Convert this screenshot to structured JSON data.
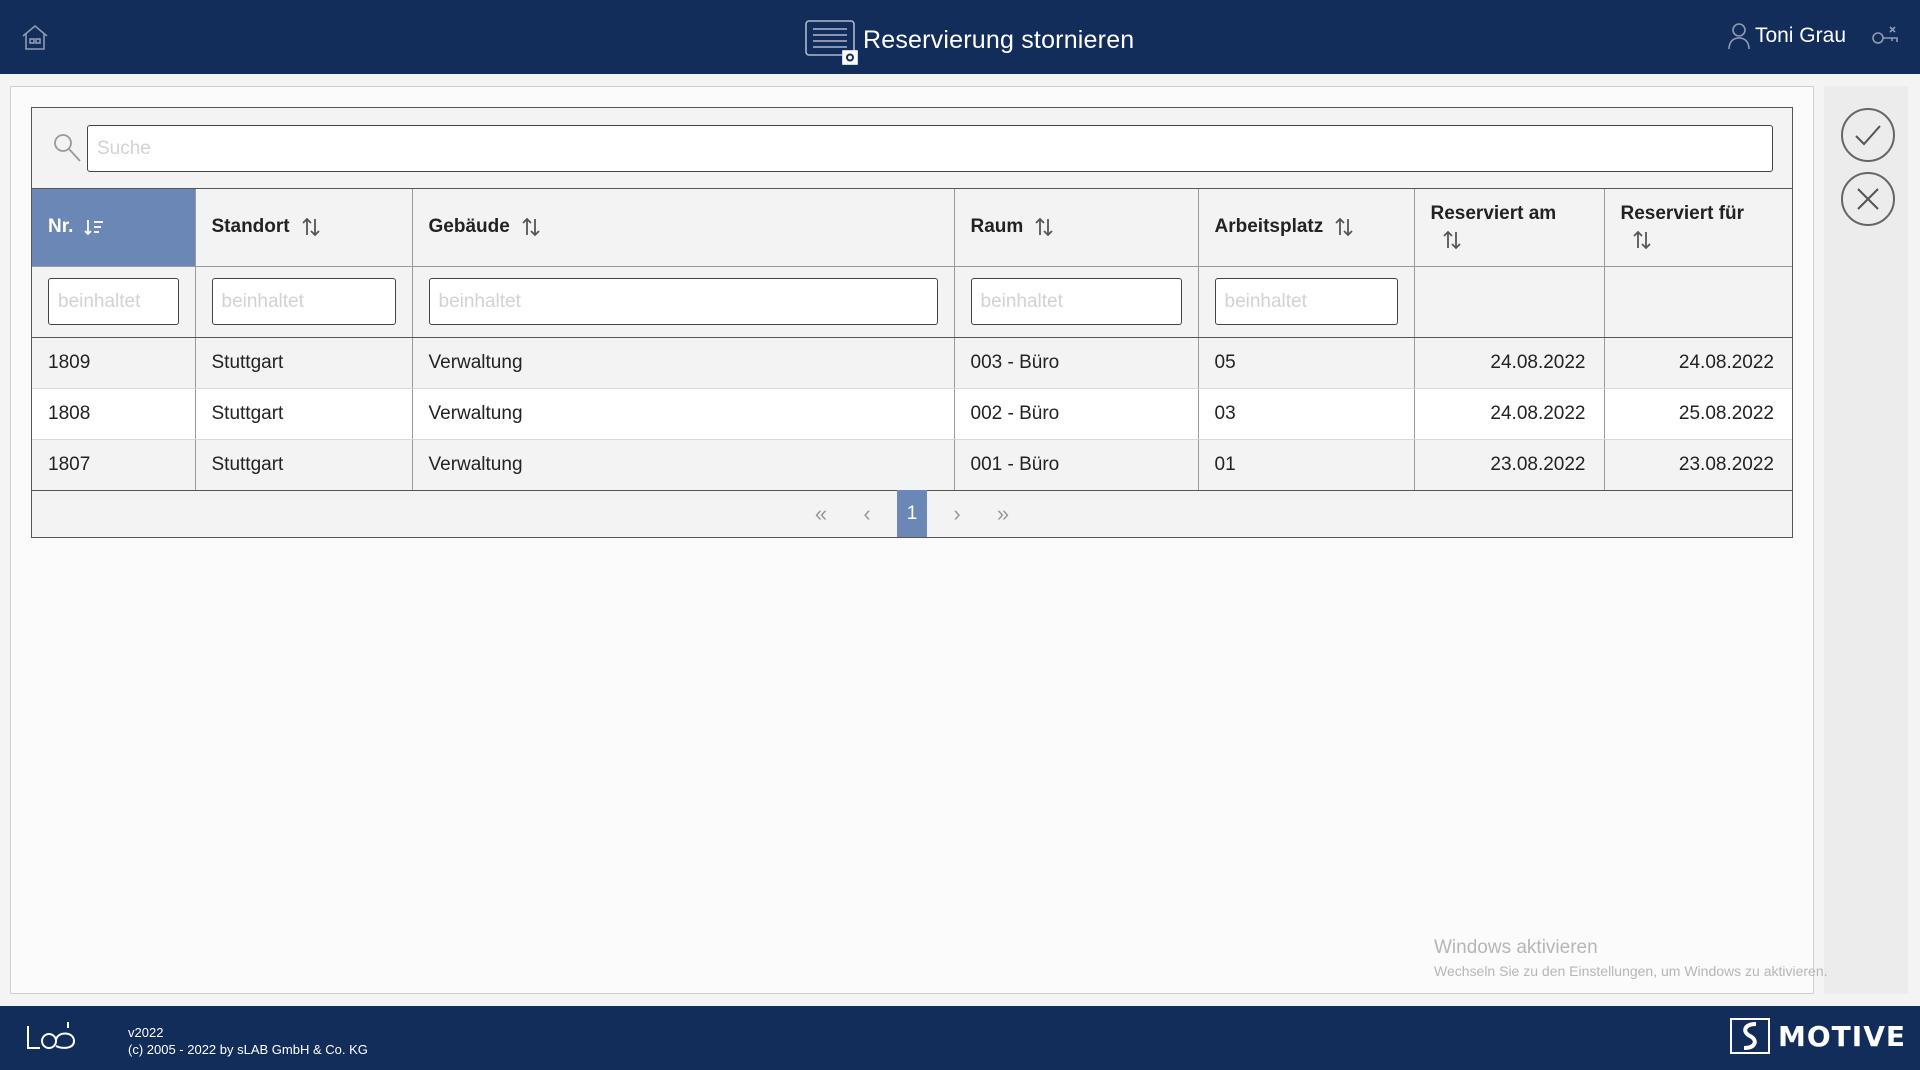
{
  "header": {
    "title": "Reservierung stornieren",
    "user_name": "Toni Grau"
  },
  "search": {
    "placeholder": "Suche"
  },
  "table": {
    "columns": [
      {
        "label": "Nr.",
        "filter_placeholder": "beinhaltet",
        "active": true
      },
      {
        "label": "Standort",
        "filter_placeholder": "beinhaltet"
      },
      {
        "label": "Gebäude",
        "filter_placeholder": "beinhaltet"
      },
      {
        "label": "Raum",
        "filter_placeholder": "beinhaltet"
      },
      {
        "label": "Arbeitsplatz",
        "filter_placeholder": "beinhaltet"
      },
      {
        "label": "Reserviert am"
      },
      {
        "label": "Reserviert für"
      }
    ],
    "rows": [
      [
        "1809",
        "Stuttgart",
        "Verwaltung",
        "003 - Büro",
        "05",
        "24.08.2022",
        "24.08.2022"
      ],
      [
        "1808",
        "Stuttgart",
        "Verwaltung",
        "002 - Büro",
        "03",
        "24.08.2022",
        "25.08.2022"
      ],
      [
        "1807",
        "Stuttgart",
        "Verwaltung",
        "001 - Büro",
        "01",
        "23.08.2022",
        "23.08.2022"
      ]
    ]
  },
  "pager": {
    "first": "«",
    "prev": "‹",
    "current": "1",
    "next": "›",
    "last": "»"
  },
  "watermark": {
    "title": "Windows aktivieren",
    "subtitle": "Wechseln Sie zu den Einstellungen, um Windows zu aktivieren."
  },
  "footer": {
    "version": "v2022",
    "copyright": "(c) 2005 - 2022 by sLAB GmbH & Co. KG",
    "brand": "MOTIVE"
  },
  "colors": {
    "header_bg": "#122d5a",
    "active_header": "#6a87b5"
  }
}
